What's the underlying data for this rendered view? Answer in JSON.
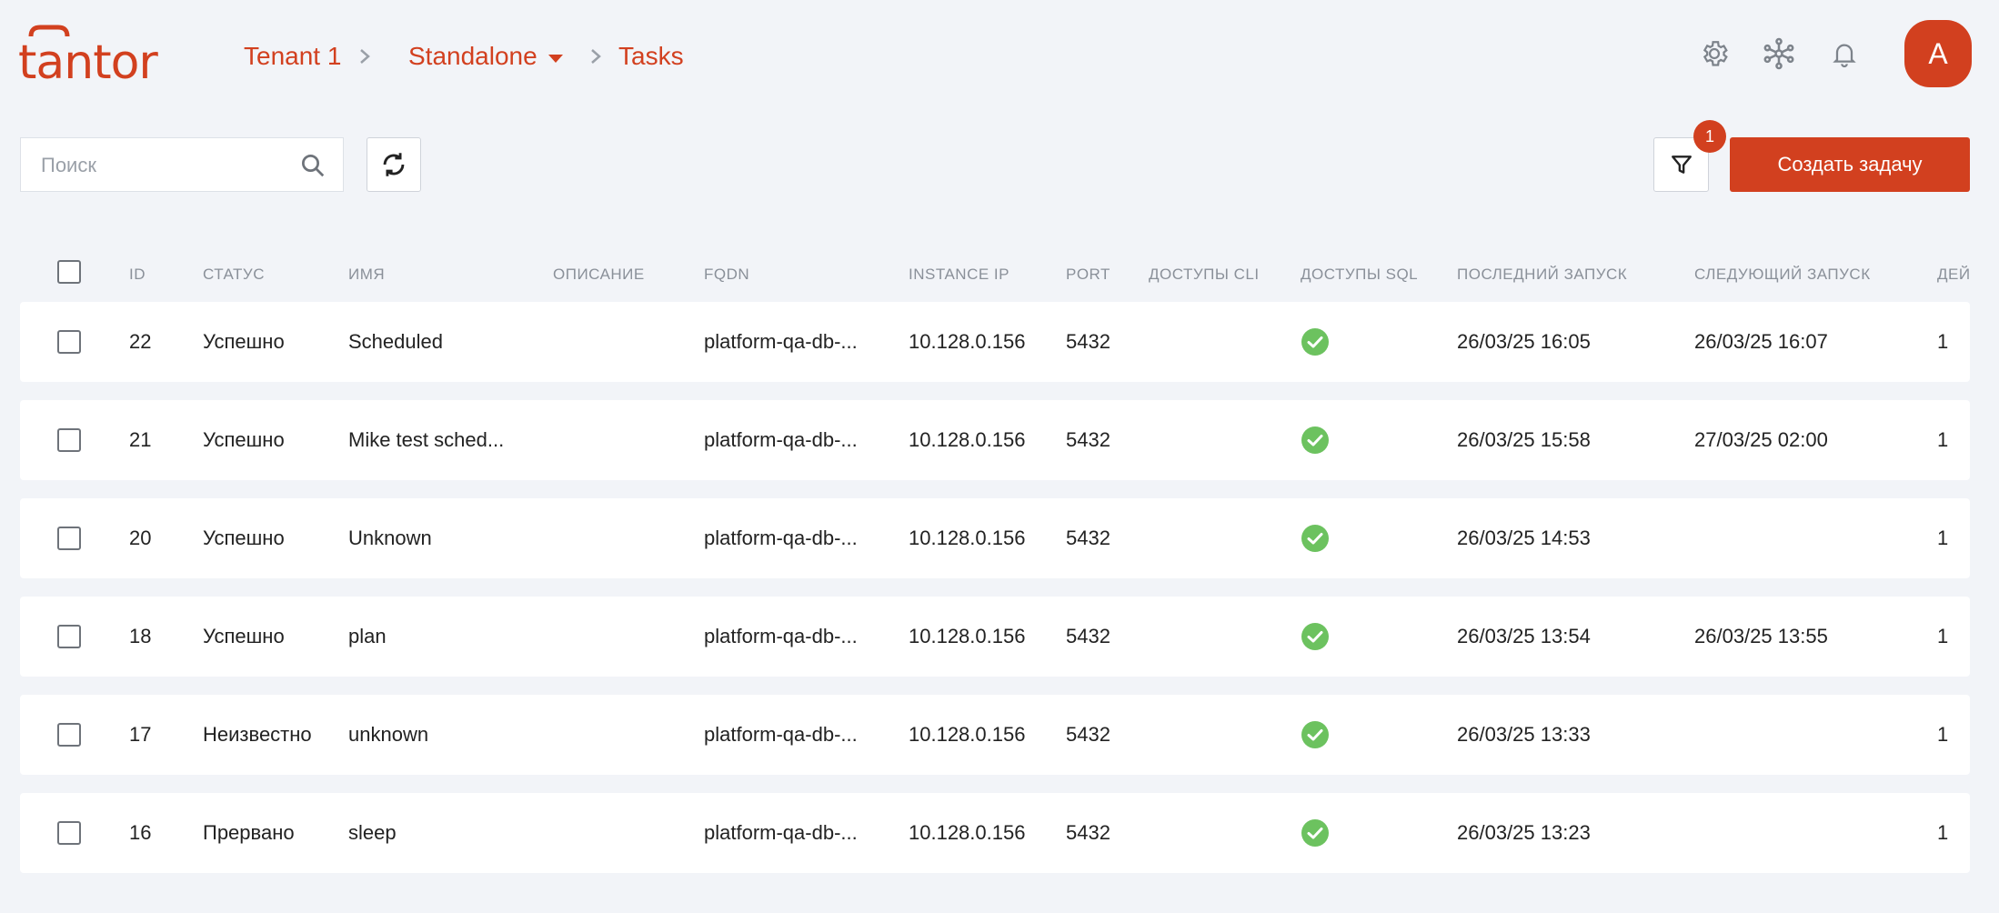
{
  "header": {
    "logo_text": "tantor",
    "breadcrumbs": [
      {
        "label": "Tenant 1"
      },
      {
        "label": "Standalone",
        "has_dropdown": true
      },
      {
        "label": "Tasks"
      }
    ],
    "icons": [
      "gear-icon",
      "network-icon",
      "bell-icon"
    ],
    "avatar_initial": "A"
  },
  "toolbar": {
    "search_placeholder": "Поиск",
    "search_value": "",
    "filter_badge": "1",
    "create_label": "Создать задачу"
  },
  "table": {
    "columns": [
      "ID",
      "СТАТУС",
      "ИМЯ",
      "ОПИСАНИЕ",
      "FQDN",
      "INSTANCE IP",
      "PORT",
      "ДОСТУПЫ CLI",
      "ДОСТУПЫ SQL",
      "ПОСЛЕДНИЙ ЗАПУСК",
      "СЛЕДУЮЩИЙ ЗАПУСК",
      "ДЕЙ"
    ],
    "rows": [
      {
        "id": "22",
        "status": "Успешно",
        "name": "Scheduled",
        "description": "",
        "fqdn": "platform-qa-db-...",
        "ip": "10.128.0.156",
        "port": "5432",
        "cli": "",
        "sql": "check",
        "last_run": "26/03/25 16:05",
        "next_run": "26/03/25 16:07",
        "extra": "1"
      },
      {
        "id": "21",
        "status": "Успешно",
        "name": "Mike test sched...",
        "description": "",
        "fqdn": "platform-qa-db-...",
        "ip": "10.128.0.156",
        "port": "5432",
        "cli": "",
        "sql": "check",
        "last_run": "26/03/25 15:58",
        "next_run": "27/03/25 02:00",
        "extra": "1"
      },
      {
        "id": "20",
        "status": "Успешно",
        "name": "Unknown",
        "description": "",
        "fqdn": "platform-qa-db-...",
        "ip": "10.128.0.156",
        "port": "5432",
        "cli": "",
        "sql": "check",
        "last_run": "26/03/25 14:53",
        "next_run": "",
        "extra": "1"
      },
      {
        "id": "18",
        "status": "Успешно",
        "name": "plan",
        "description": "",
        "fqdn": "platform-qa-db-...",
        "ip": "10.128.0.156",
        "port": "5432",
        "cli": "",
        "sql": "check",
        "last_run": "26/03/25 13:54",
        "next_run": "26/03/25 13:55",
        "extra": "1"
      },
      {
        "id": "17",
        "status": "Неизвестно",
        "name": "unknown",
        "description": "",
        "fqdn": "platform-qa-db-...",
        "ip": "10.128.0.156",
        "port": "5432",
        "cli": "",
        "sql": "check",
        "last_run": "26/03/25 13:33",
        "next_run": "",
        "extra": "1"
      },
      {
        "id": "16",
        "status": "Прервано",
        "name": "sleep",
        "description": "",
        "fqdn": "platform-qa-db-...",
        "ip": "10.128.0.156",
        "port": "5432",
        "cli": "",
        "sql": "check",
        "last_run": "26/03/25 13:23",
        "next_run": "",
        "extra": "1"
      }
    ]
  },
  "colors": {
    "accent": "#d2401f",
    "success": "#6cc25f",
    "background": "#f2f4f8"
  }
}
